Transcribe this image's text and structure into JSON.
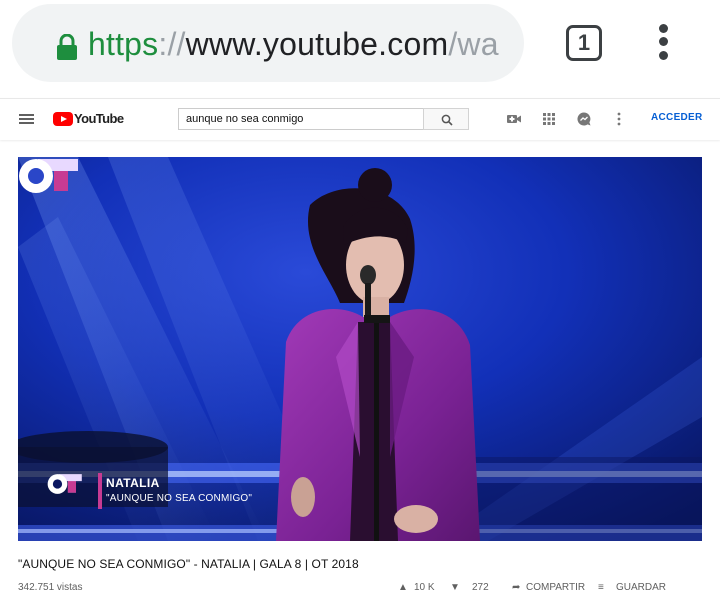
{
  "browser": {
    "url_scheme": "https",
    "url_separator": "://",
    "url_host": "www.youtube.com",
    "url_path": "/wa",
    "tab_count": "1"
  },
  "youtube": {
    "logo_text": "YouTube",
    "search": {
      "value": "aunque no sea conmigo"
    },
    "signin_label": "ACCEDER"
  },
  "video": {
    "overlay_name": "NATALIA",
    "overlay_song": "\"AUNQUE NO SEA CONMIGO\"",
    "title": "\"AUNQUE NO SEA CONMIGO\" - NATALIA | GALA 8 | OT 2018",
    "views": "342.751 vistas",
    "likes": "10 K",
    "dislikes": "272",
    "share_label": "COMPARTIR",
    "save_label": "GUARDAR"
  },
  "colors": {
    "url_green": "#1e8e3e",
    "youtube_red": "#ff0000",
    "signin_blue": "#065fd4",
    "stage_blue": "#1230b8",
    "jacket_purple": "#8a2aa0"
  },
  "icons": [
    "lock-icon",
    "tabs-icon",
    "more-vert-icon",
    "menu-icon",
    "youtube-logo",
    "search-icon",
    "create-video-icon",
    "apps-icon",
    "messages-icon",
    "settings-more-icon",
    "like-icon",
    "dislike-icon",
    "share-icon",
    "save-icon"
  ]
}
